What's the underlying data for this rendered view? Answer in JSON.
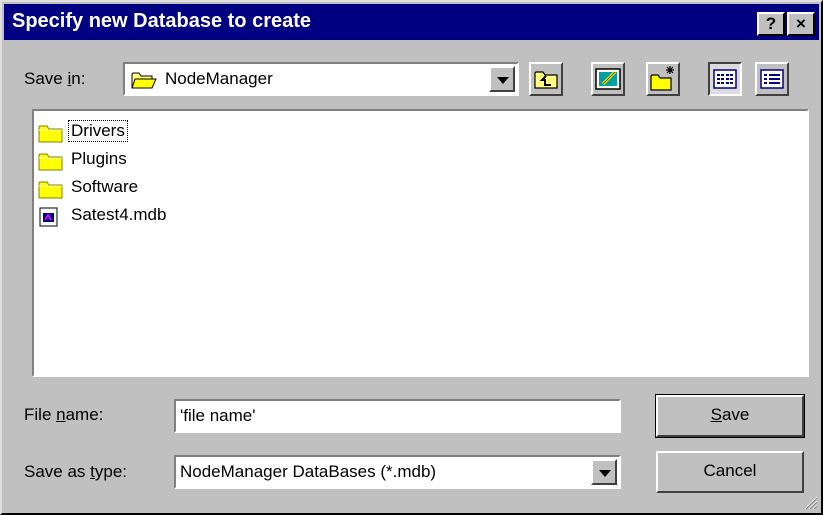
{
  "window": {
    "title": "Specify new Database to create",
    "help_glyph": "?",
    "close_glyph": "×"
  },
  "save_in": {
    "label_prefix": "Save ",
    "label_access": "i",
    "label_suffix": "n:",
    "value": "NodeManager"
  },
  "toolbar": [
    {
      "name": "up-one-level-icon"
    },
    {
      "name": "desktop-icon"
    },
    {
      "name": "create-new-folder-icon"
    },
    {
      "name": "list-view-icon"
    },
    {
      "name": "details-view-icon"
    }
  ],
  "files": [
    {
      "label": "Drivers",
      "type": "folder"
    },
    {
      "label": "Plugins",
      "type": "folder"
    },
    {
      "label": "Software",
      "type": "folder"
    },
    {
      "label": "Satest4.mdb",
      "type": "mdb-file"
    }
  ],
  "file_name": {
    "label_prefix": "File ",
    "label_access": "n",
    "label_suffix": "ame:",
    "value": "'file name'"
  },
  "save_as_type": {
    "label_prefix": "Save as ",
    "label_access": "t",
    "label_suffix": "ype:",
    "value": "NodeManager DataBases (*.mdb)"
  },
  "buttons": {
    "save_access": "S",
    "save_rest": "ave",
    "cancel": "Cancel"
  },
  "colors": {
    "title_bar": "#000080",
    "face": "#c0c0c0",
    "folder": "#ffff00"
  }
}
